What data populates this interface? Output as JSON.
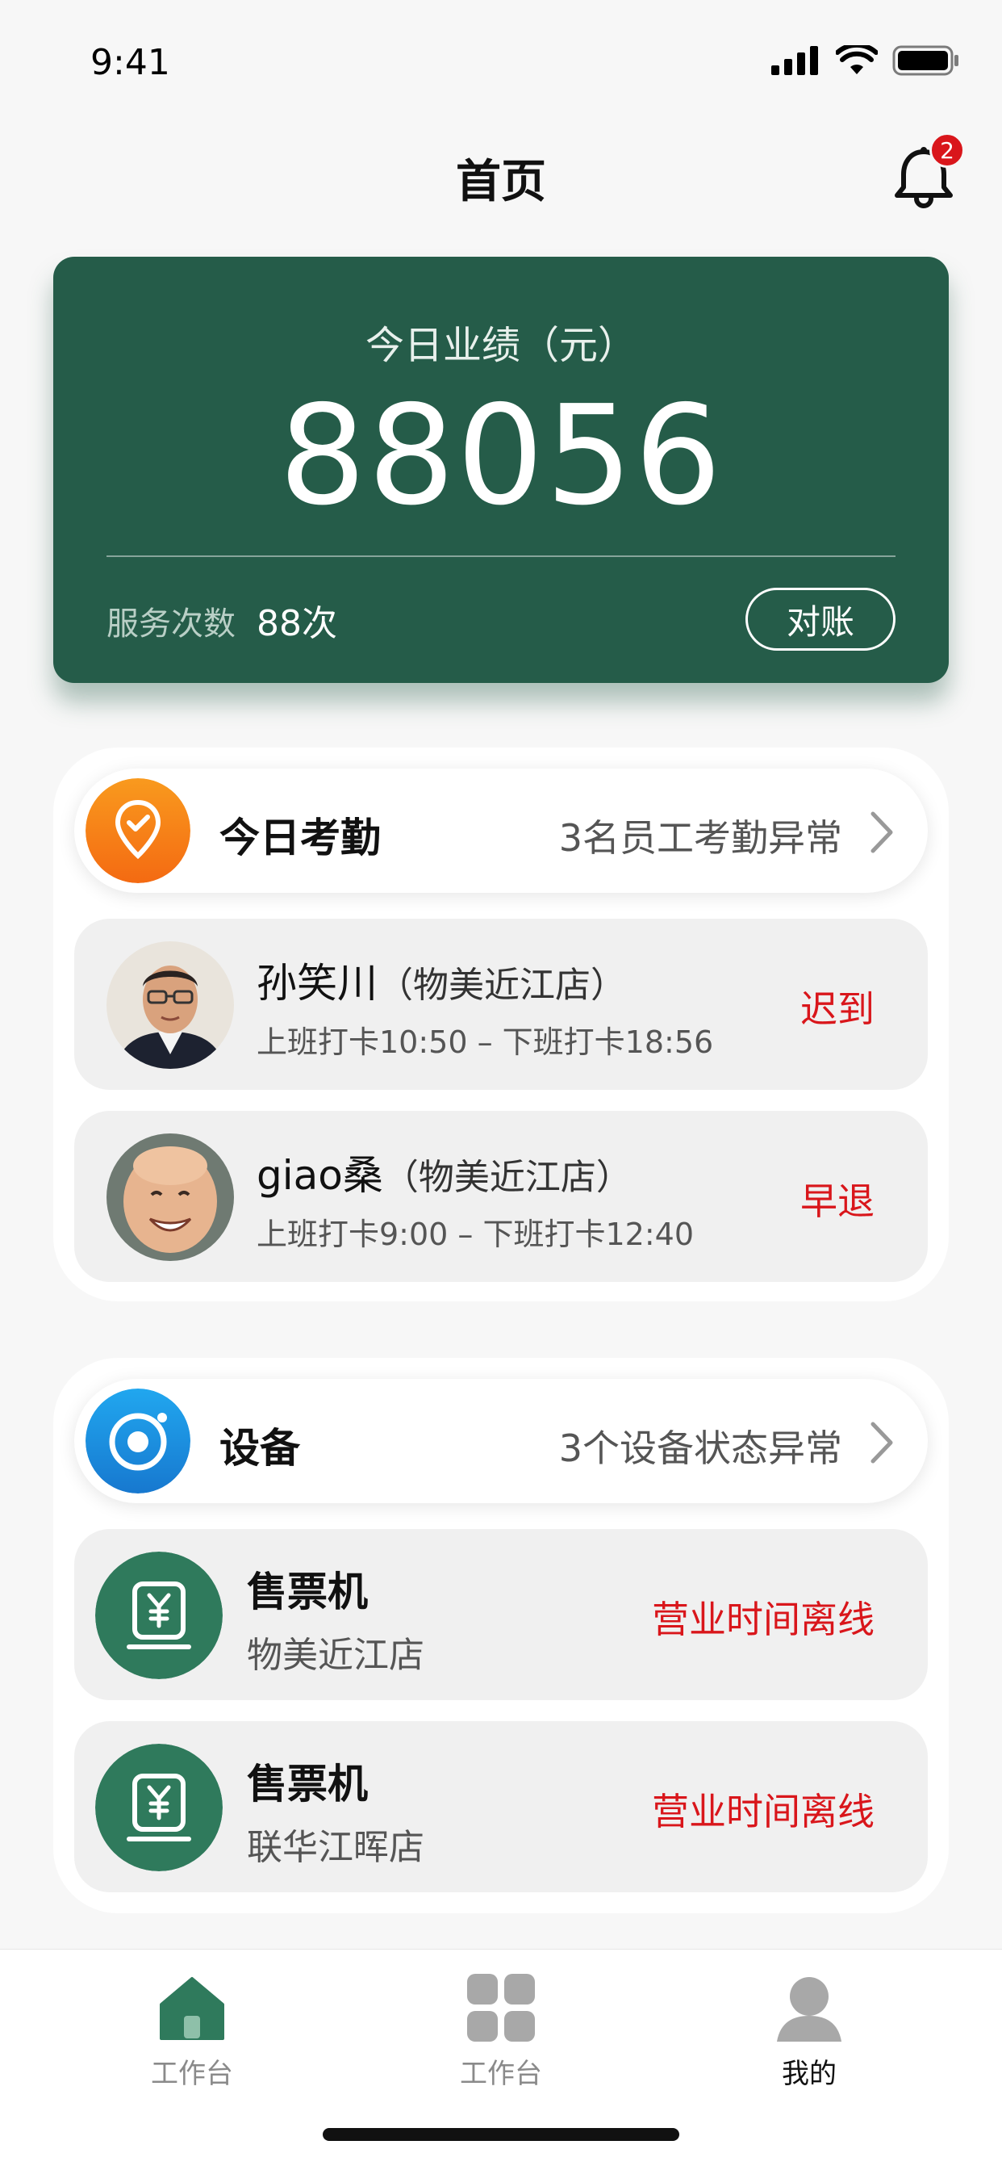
{
  "status_bar": {
    "time": "9:41"
  },
  "header": {
    "title": "首页",
    "notification_count": "2"
  },
  "performance": {
    "label": "今日业绩（元）",
    "value": "88056",
    "service_label": "服务次数",
    "service_value": "88次",
    "reconcile_label": "对账"
  },
  "attendance": {
    "title": "今日考勤",
    "summary": "3名员工考勤异常",
    "items": [
      {
        "name": "孙笑川",
        "store": "（物美近江店）",
        "time": "上班打卡10:50 – 下班打卡18:56",
        "status": "迟到"
      },
      {
        "name": "giao桑",
        "store": "（物美近江店）",
        "time": "上班打卡9:00 – 下班打卡12:40",
        "status": "早退"
      }
    ]
  },
  "devices": {
    "title": "设备",
    "summary": "3个设备状态异常",
    "items": [
      {
        "name": "售票机",
        "store": "物美近江店",
        "status": "营业时间离线"
      },
      {
        "name": "售票机",
        "store": "联华江晖店",
        "status": "营业时间离线"
      }
    ]
  },
  "tab_bar": {
    "tabs": [
      {
        "label": "工作台",
        "icon": "home-icon"
      },
      {
        "label": "工作台",
        "icon": "grid-icon"
      },
      {
        "label": "我的",
        "icon": "person-icon"
      }
    ]
  },
  "colors": {
    "brand": "#255c49",
    "alert": "#d9161b",
    "orange": "#f7841c",
    "blue": "#1a8fe0"
  }
}
